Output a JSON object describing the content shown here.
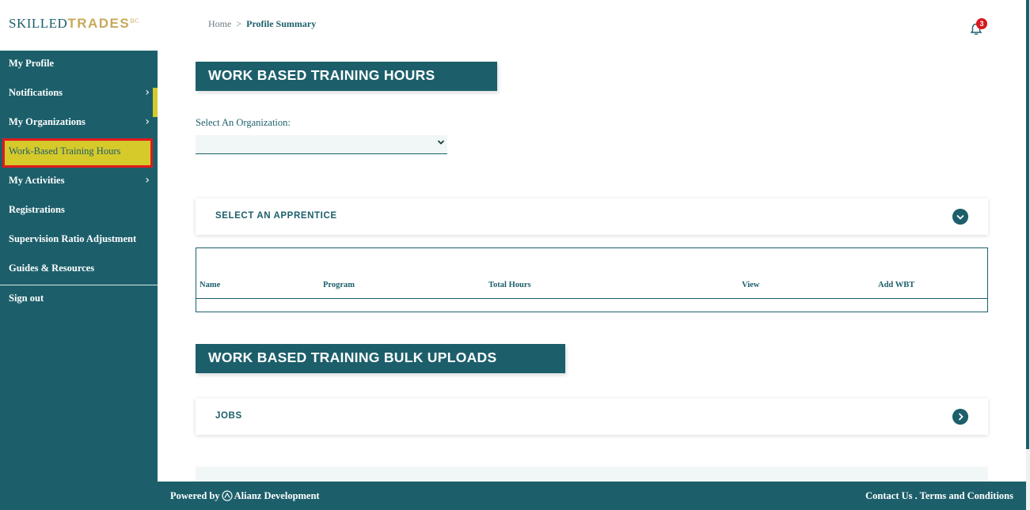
{
  "logo": {
    "part1": "SKILLED",
    "part2": "TRADES",
    "sup": "BC"
  },
  "breadcrumb": {
    "home": "Home",
    "separator": ">",
    "current": "Profile Summary"
  },
  "notifications": {
    "count": "3"
  },
  "sidebar": {
    "items": [
      {
        "label": "My Profile"
      },
      {
        "label": "Notifications"
      },
      {
        "label": "My Organizations"
      },
      {
        "label": "Work-Based Training Hours"
      },
      {
        "label": "My Activities"
      },
      {
        "label": "Registrations"
      },
      {
        "label": "Supervision Ratio Adjustment"
      },
      {
        "label": "Guides & Resources"
      },
      {
        "label": "Sign out"
      }
    ],
    "chevron": "›"
  },
  "main": {
    "wbt_title": "WORK BASED TRAINING HOURS",
    "org_label": "Select An Organization:",
    "org_value": "",
    "apprentice_label": "SELECT AN APPRENTICE",
    "table": {
      "columns": [
        "Name",
        "Program",
        "Total Hours",
        "View",
        "Add WBT"
      ]
    },
    "bulk_title": "WORK BASED TRAINING BULK UPLOADS",
    "jobs_label": "JOBS"
  },
  "footer": {
    "powered_by": "Powered by",
    "company": "Alianz Development",
    "links": "Contact Us . Terms and Conditions"
  },
  "colors": {
    "primary": "#1c5f6b",
    "gold": "#c9a85b",
    "highlight": "#d6c92a",
    "badge": "#d9181f"
  }
}
